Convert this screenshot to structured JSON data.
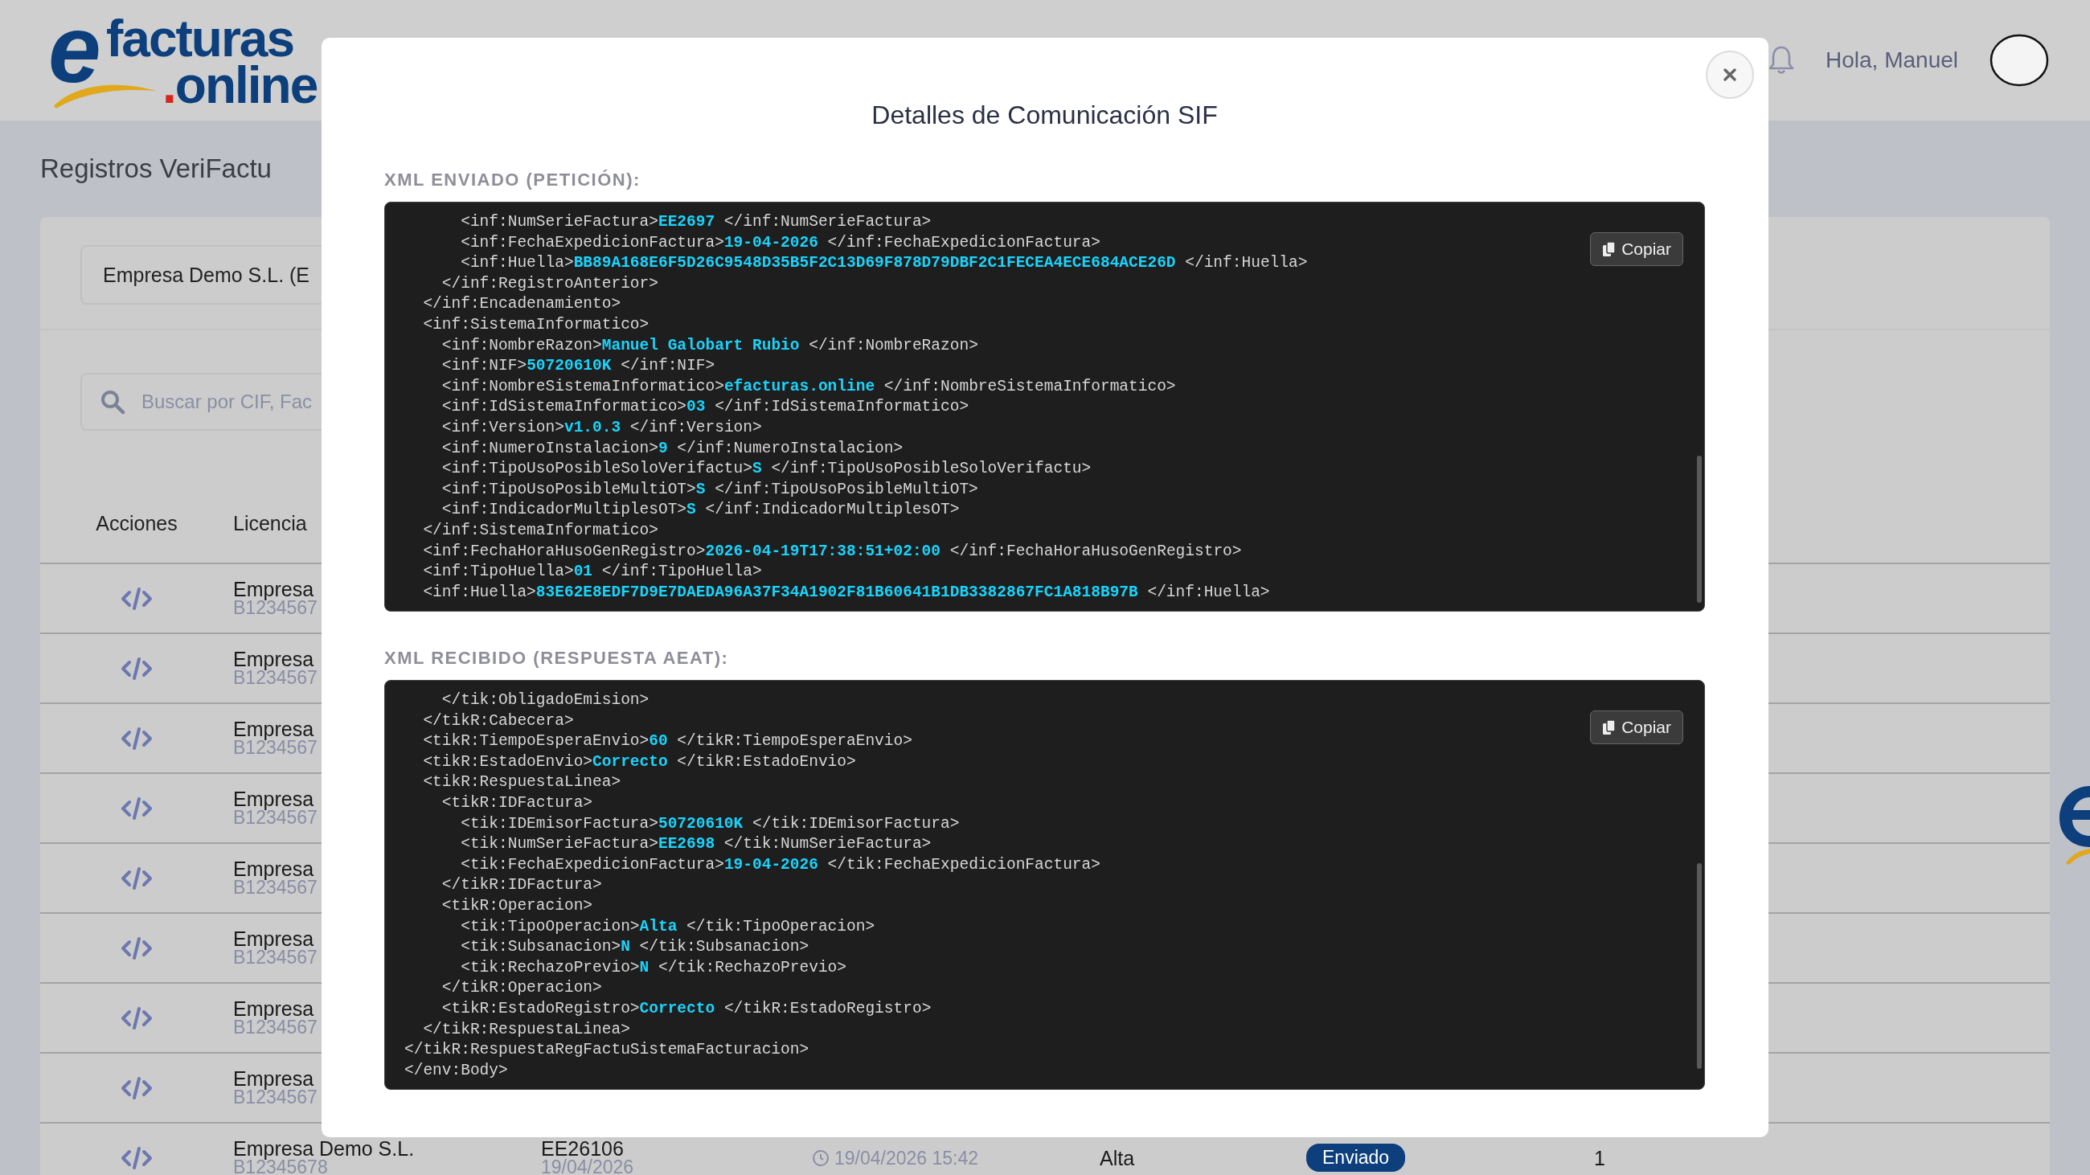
{
  "header": {
    "logo": {
      "mark": "e",
      "line_1": "facturas",
      "line_2": ".online"
    },
    "greeting": "Hola, Manuel"
  },
  "page": {
    "title": "Registros VeriFactu",
    "company_select": "Empresa Demo S.L. (E",
    "search": {
      "placeholder": "Buscar por CIF, Fac"
    }
  },
  "table": {
    "columns": [
      "Acciones",
      "Licencia"
    ],
    "rows": [
      {
        "licencia": "Empresa",
        "nif": "B1234567"
      },
      {
        "licencia": "Empresa",
        "nif": "B1234567"
      },
      {
        "licencia": "Empresa",
        "nif": "B1234567"
      },
      {
        "licencia": "Empresa",
        "nif": "B1234567"
      },
      {
        "licencia": "Empresa",
        "nif": "B1234567"
      },
      {
        "licencia": "Empresa",
        "nif": "B1234567"
      },
      {
        "licencia": "Empresa",
        "nif": "B1234567"
      },
      {
        "licencia": "Empresa",
        "nif": "B1234567"
      },
      {
        "licencia": "Empresa Demo S.L.",
        "nif": "B12345678",
        "numero": "EE26106",
        "fecha": "19/04/2026",
        "fecha_envio": "19/04/2026 15:42",
        "tipo": "Alta",
        "estado": "Enviado",
        "column_7": "1"
      }
    ]
  },
  "modal": {
    "title": "Detalles de Comunicación SIF",
    "sections": [
      {
        "label": "XML ENVIADO (PETICIÓN):",
        "copy_button": "Copiar",
        "lines": [
          {
            "text": "      <inf:NumSerieFactura>",
            "value": "EE2697",
            "close": "</inf:NumSerieFactura>"
          },
          {
            "text": "      <inf:FechaExpedicionFactura>",
            "value": "19-04-2026",
            "close": "</inf:FechaExpedicionFactura>"
          },
          {
            "text": "      <inf:Huella>",
            "value": "BB89A168E6F5D26C9548D35B5F2C13D69F878D79DBF2C1FECEA4ECE684ACE26D",
            "close": "</inf:Huella>"
          },
          {
            "text": "    </inf:RegistroAnterior>"
          },
          {
            "text": "  </inf:Encadenamiento>"
          },
          {
            "text": "  <inf:SistemaInformatico>"
          },
          {
            "text": "    <inf:NombreRazon>",
            "value": "Manuel Galobart Rubio",
            "close": "</inf:NombreRazon>"
          },
          {
            "text": "    <inf:NIF>",
            "value": "50720610K",
            "close": "</inf:NIF>"
          },
          {
            "text": "    <inf:NombreSistemaInformatico>",
            "value": "efacturas.online",
            "close": "</inf:NombreSistemaInformatico>"
          },
          {
            "text": "    <inf:IdSistemaInformatico>",
            "value": "03",
            "close": "</inf:IdSistemaInformatico>"
          },
          {
            "text": "    <inf:Version>",
            "value": "v1.0.3",
            "close": "</inf:Version>"
          },
          {
            "text": "    <inf:NumeroInstalacion>",
            "value": "9",
            "close": "</inf:NumeroInstalacion>"
          },
          {
            "text": "    <inf:TipoUsoPosibleSoloVerifactu>",
            "value": "S",
            "close": "</inf:TipoUsoPosibleSoloVerifactu>"
          },
          {
            "text": "    <inf:TipoUsoPosibleMultiOT>",
            "value": "S",
            "close": "</inf:TipoUsoPosibleMultiOT>"
          },
          {
            "text": "    <inf:IndicadorMultiplesOT>",
            "value": "S",
            "close": "</inf:IndicadorMultiplesOT>"
          },
          {
            "text": "  </inf:SistemaInformatico>"
          },
          {
            "text": "  <inf:FechaHoraHusoGenRegistro>",
            "value": "2026-04-19T17:38:51+02:00",
            "close": "</inf:FechaHoraHusoGenRegistro>"
          },
          {
            "text": "  <inf:TipoHuella>",
            "value": "01",
            "close": "</inf:TipoHuella>"
          },
          {
            "text": "  <inf:Huella>",
            "value": "83E62E8EDF7D9E7DAEDA96A37F34A1902F81B60641B1DB3382867FC1A818B97B",
            "close": "</inf:Huella>"
          }
        ]
      },
      {
        "label": "XML RECIBIDO (RESPUESTA AEAT):",
        "copy_button": "Copiar",
        "lines": [
          {
            "text": "    </tik:ObligadoEmision>"
          },
          {
            "text": "  </tikR:Cabecera>"
          },
          {
            "text": "  <tikR:TiempoEsperaEnvio>",
            "value": "60",
            "close": "</tikR:TiempoEsperaEnvio>"
          },
          {
            "text": "  <tikR:EstadoEnvio>",
            "value": "Correcto",
            "close": "</tikR:EstadoEnvio>"
          },
          {
            "text": "  <tikR:RespuestaLinea>"
          },
          {
            "text": "    <tikR:IDFactura>"
          },
          {
            "text": "      <tik:IDEmisorFactura>",
            "value": "50720610K",
            "close": "</tik:IDEmisorFactura>"
          },
          {
            "text": "      <tik:NumSerieFactura>",
            "value": "EE2698",
            "close": "</tik:NumSerieFactura>"
          },
          {
            "text": "      <tik:FechaExpedicionFactura>",
            "value": "19-04-2026",
            "close": "</tik:FechaExpedicionFactura>"
          },
          {
            "text": "    </tikR:IDFactura>"
          },
          {
            "text": "    <tikR:Operacion>"
          },
          {
            "text": "      <tik:TipoOperacion>",
            "value": "Alta",
            "close": "</tik:TipoOperacion>"
          },
          {
            "text": "      <tik:Subsanacion>",
            "value": "N",
            "close": "</tik:Subsanacion>"
          },
          {
            "text": "      <tik:RechazoPrevio>",
            "value": "N",
            "close": "</tik:RechazoPrevio>"
          },
          {
            "text": "    </tikR:Operacion>"
          },
          {
            "text": "    <tikR:EstadoRegistro>",
            "value": "Correcto",
            "close": "</tikR:EstadoRegistro>"
          },
          {
            "text": "  </tikR:RespuestaLinea>"
          },
          {
            "text": "</tikR:RespuestaRegFactuSistemaFacturacion>"
          },
          {
            "text": "</env:Body>"
          }
        ]
      }
    ]
  }
}
